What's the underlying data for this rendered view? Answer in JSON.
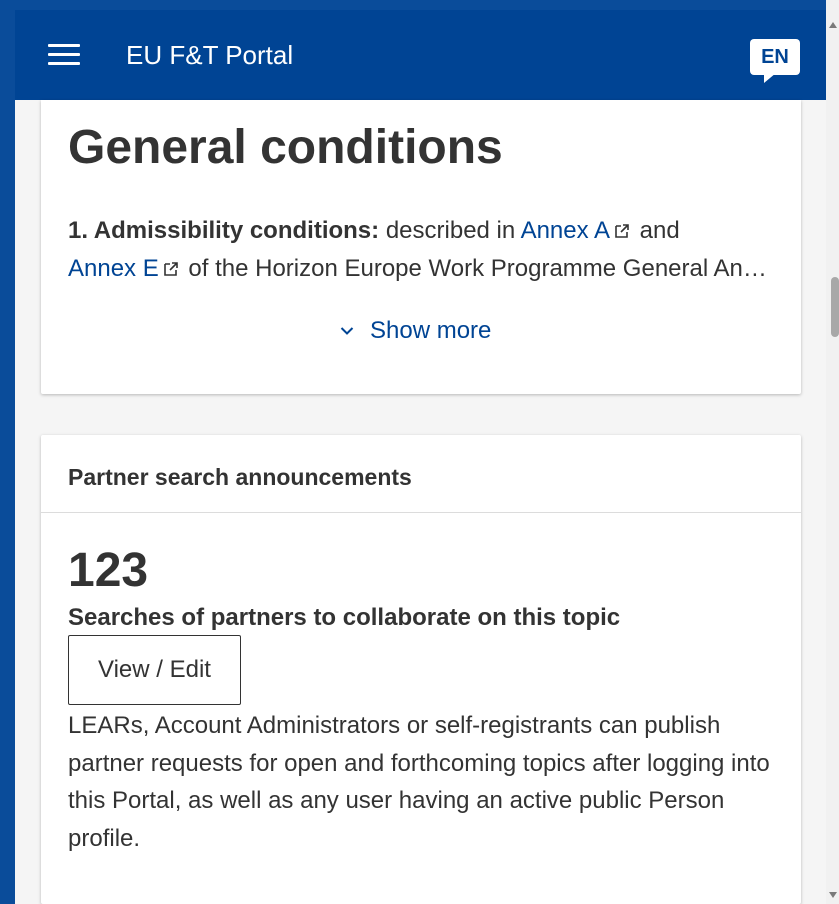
{
  "header": {
    "menu_icon": "hamburger-menu-icon",
    "title": "EU F&T Portal",
    "language": "EN",
    "brand_color": "#004494"
  },
  "general_conditions": {
    "title": "General conditions",
    "item_label": "1. Admissibility conditions:",
    "text_before": " described in ",
    "link1": "Annex A",
    "text_mid": " and",
    "link2": "Annex E",
    "text_after": " of the Horizon Europe Work Programme General Annexes",
    "external_icon": "external-link-icon",
    "show_more_label": "Show more",
    "show_more_icon": "chevron-down-icon"
  },
  "partner_search": {
    "header": "Partner search announcements",
    "count": "123",
    "subtitle": "Searches of partners to collaborate on this topic",
    "button_label": "View / Edit",
    "description": "LEARs, Account Administrators or self-registrants can publish partner requests for open and forthcoming topics after logging into this Portal, as well as any user having an active public Person profile."
  }
}
